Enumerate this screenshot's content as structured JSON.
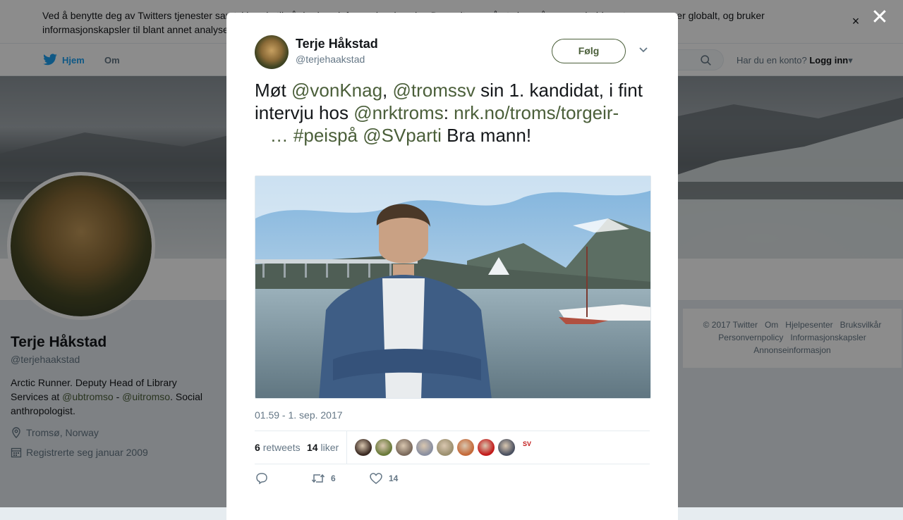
{
  "cookie_banner": {
    "text": "Ved å benytte deg av Twitters tjenester samtykker du til vår bruk av informasjonskapsler. Du godtar også at vi og våre samarbeidspartnere opererer globalt, og bruker informasjonskapsler til blant annet analyse, personalisering og annonser.",
    "close": "×"
  },
  "nav": {
    "home": "Hjem",
    "about": "Om",
    "account_question": "Har du en konto?",
    "login": "Logg inn",
    "login_caret": "▾"
  },
  "profile": {
    "name": "Terje Håkstad",
    "handle": "@terjehaakstad",
    "bio_1": "Arctic Runner. Deputy Head of Library Services at ",
    "bio_mention_1": "@ubtromso",
    "bio_sep": " - ",
    "bio_mention_2": "@uitromso",
    "bio_2": ". Social anthropologist.",
    "location": "Tromsø, Norway",
    "joined": "Registrerte seg januar 2009"
  },
  "footer": {
    "links": [
      "© 2017 Twitter",
      "Om",
      "Hjelpesenter",
      "Bruksvilkår",
      "Personvernpolicy",
      "Informasjonskapsler",
      "Annonseinformasjon"
    ]
  },
  "overlay_close": "✕",
  "tweet": {
    "author_name": "Terje Håkstad",
    "author_handle": "@terjehaakstad",
    "follow_label": "Følg",
    "text_1": "Møt ",
    "mention_1": "@vonKnag",
    "text_2": ", ",
    "mention_2": "@tromssv",
    "text_3": " sin 1. kandidat, i fint intervju hos ",
    "mention_3": "@nrktroms",
    "text_4": ": ",
    "link": "nrk.no/troms/torgeir-",
    "ellipsis": "…",
    "hashtag": "#peispå",
    "mention_4": "@SVparti",
    "text_5": " Bra mann!",
    "timestamp": "01.59 - 1. sep. 2017",
    "retweets_count": "6",
    "retweets_label": "retweets",
    "likes_count": "14",
    "likes_label": "liker",
    "action_retweet_count": "6",
    "action_like_count": "14"
  },
  "likers": [
    {
      "color": "#3b2a22"
    },
    {
      "color": "#6a7a3a"
    },
    {
      "color": "#7b6a5c"
    },
    {
      "color": "#8a8fa0"
    },
    {
      "color": "#9c9070"
    },
    {
      "color": "#c46a3a"
    },
    {
      "color": "#c21b1b"
    },
    {
      "color": "#4a5060"
    }
  ],
  "liker_logo": "SV",
  "colors": {
    "link": "#4b5f3a",
    "twitter_blue": "#1da1f2",
    "muted": "#657786"
  }
}
